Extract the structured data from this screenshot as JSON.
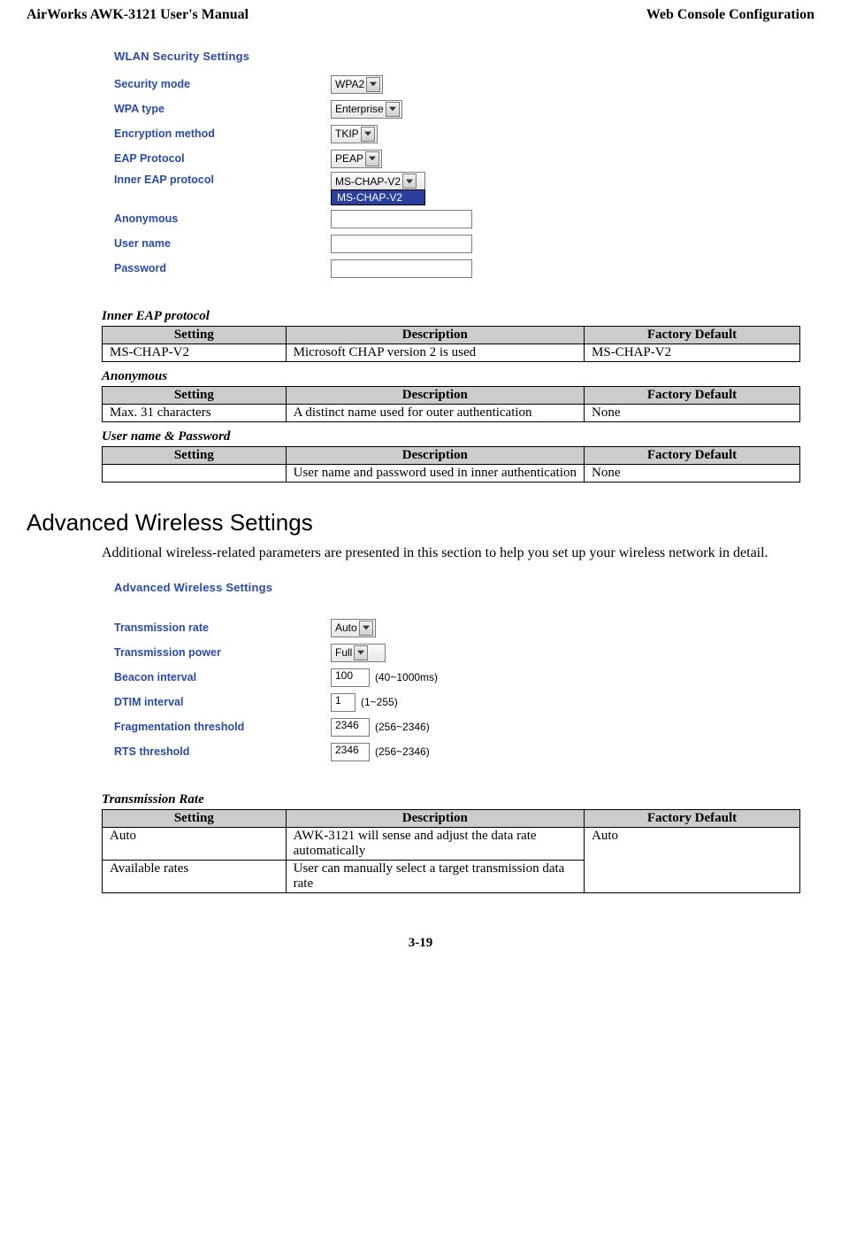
{
  "header": {
    "left": "AirWorks AWK-3121 User's Manual",
    "right": "Web Console Configuration"
  },
  "panel1": {
    "title": "WLAN Security Settings",
    "rows": {
      "security_mode": {
        "label": "Security mode",
        "value": "WPA2"
      },
      "wpa_type": {
        "label": "WPA type",
        "value": "Enterprise"
      },
      "encryption": {
        "label": "Encryption method",
        "value": "TKIP"
      },
      "eap_protocol": {
        "label": "EAP Protocol",
        "value": "PEAP"
      },
      "inner_eap": {
        "label": "Inner EAP protocol",
        "value": "MS-CHAP-V2",
        "open_option": "MS-CHAP-V2"
      },
      "anonymous": {
        "label": "Anonymous",
        "value": ""
      },
      "username": {
        "label": "User name",
        "value": ""
      },
      "password": {
        "label": "Password",
        "value": ""
      }
    }
  },
  "tables": {
    "inner_eap": {
      "caption": "Inner EAP protocol",
      "headers": [
        "Setting",
        "Description",
        "Factory Default"
      ],
      "rows": [
        [
          "MS-CHAP-V2",
          "Microsoft CHAP version 2 is used",
          "MS-CHAP-V2"
        ]
      ]
    },
    "anonymous": {
      "caption": "Anonymous",
      "headers": [
        "Setting",
        "Description",
        "Factory Default"
      ],
      "rows": [
        [
          "Max. 31 characters",
          "A distinct name used for outer authentication",
          "None"
        ]
      ]
    },
    "userpass": {
      "caption": "User name & Password",
      "headers": [
        "Setting",
        "Description",
        "Factory Default"
      ],
      "rows": [
        [
          "",
          "User name and password used in inner authentication",
          "None"
        ]
      ]
    },
    "tx_rate": {
      "caption": "Transmission Rate",
      "headers": [
        "Setting",
        "Description",
        "Factory Default"
      ],
      "rows": [
        [
          "Auto",
          "AWK-3121 will sense and adjust the data rate automatically",
          "Auto"
        ],
        [
          "Available rates",
          "User can manually select a target transmission data rate",
          ""
        ]
      ],
      "merge_last_col_rows": 2
    }
  },
  "adv_heading": "Advanced Wireless Settings",
  "adv_body": "Additional wireless-related parameters are presented in this section to help you set up your wireless network in detail.",
  "panel2": {
    "title": "Advanced Wireless Settings",
    "rows": {
      "tx_rate": {
        "label": "Transmission rate",
        "value": "Auto"
      },
      "tx_power": {
        "label": "Transmission power",
        "value": "Full"
      },
      "beacon": {
        "label": "Beacon interval",
        "value": "100",
        "hint": "(40~1000ms)"
      },
      "dtim": {
        "label": "DTIM interval",
        "value": "1",
        "hint": "(1~255)"
      },
      "frag": {
        "label": "Fragmentation threshold",
        "value": "2346",
        "hint": "(256~2346)"
      },
      "rts": {
        "label": "RTS threshold",
        "value": "2346",
        "hint": "(256~2346)"
      }
    }
  },
  "footer": "3-19"
}
